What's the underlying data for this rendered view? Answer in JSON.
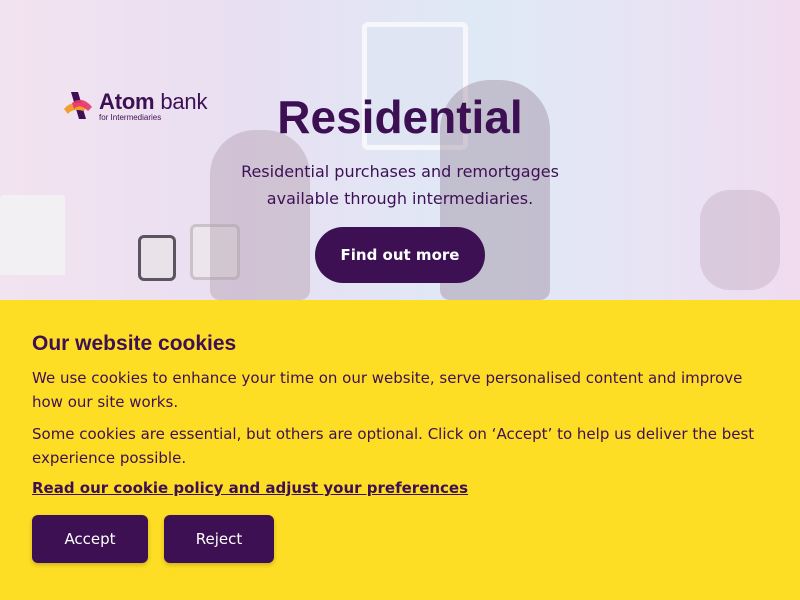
{
  "brand": {
    "name_bold": "Atom",
    "name_rest": " bank",
    "tagline": "for Intermediaries"
  },
  "hero": {
    "title": "Residential",
    "subtitle": "Residential purchases and remortgages available through intermediaries.",
    "cta_label": "Find out more"
  },
  "cookies": {
    "title": "Our website cookies",
    "paragraph_1": "We use cookies to enhance your time on our website, serve personalised content and improve how our site works.",
    "paragraph_2": "Some cookies are essential, but others are optional. Click on ‘Accept’ to help us deliver the best experience possible.",
    "policy_link": "Read our cookie policy and adjust your preferences",
    "accept_label": "Accept",
    "reject_label": "Reject"
  },
  "colors": {
    "brand_purple": "#3d1054",
    "banner_yellow": "#fedd25"
  }
}
